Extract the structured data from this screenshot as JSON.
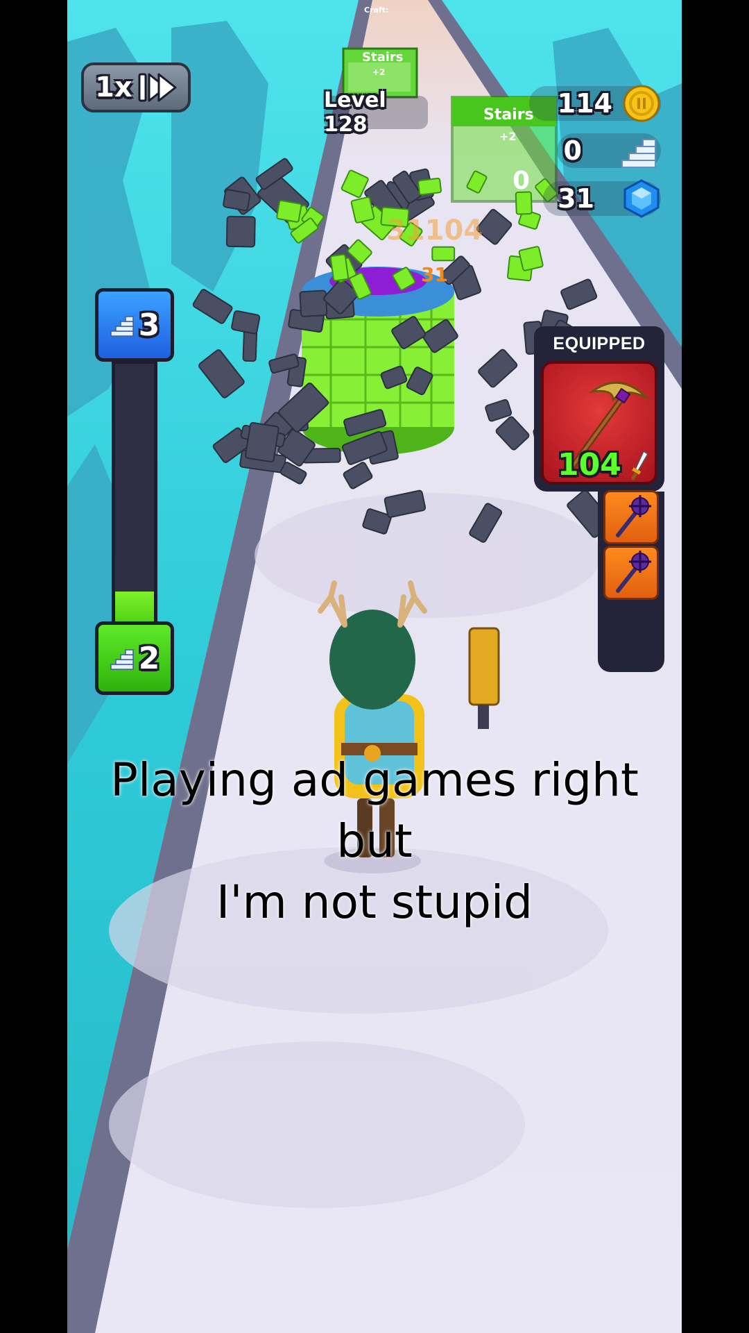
{
  "hud": {
    "speed_label": "1x",
    "level_label": "Level 128",
    "coins": "114",
    "stairs_count": "0",
    "gems": "31"
  },
  "gates": {
    "far_gate_label": "Stairs",
    "far_gate_bonus": "+2",
    "near_gate_label": "Stairs",
    "near_gate_bonus": "+2",
    "near_gate_count": "0",
    "craft_label": "Craft:"
  },
  "progress": {
    "next_stairs": "3",
    "current_stairs": "2",
    "fill_fraction": 0.16
  },
  "hit_numbers": {
    "floating_damage": "31104",
    "small_damage": "31"
  },
  "equipped": {
    "title": "EQUIPPED",
    "weapon_power": "104",
    "weapon_icon": "pickaxe-icon",
    "inventory_icons": [
      "mace-icon",
      "mace-icon"
    ]
  },
  "caption": {
    "line1": "Playing ad games right but",
    "line2": "I'm not stupid"
  },
  "colors": {
    "sky": "#37d3e0",
    "track": "#e6e3f4",
    "tower_green": "#7ded2a",
    "equipped_red": "#d8242e",
    "panel_dark": "#23233a"
  }
}
